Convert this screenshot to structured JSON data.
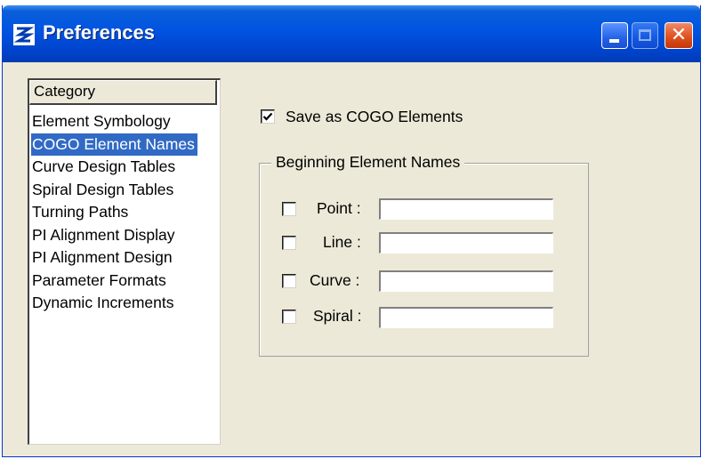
{
  "window": {
    "title": "Preferences"
  },
  "category": {
    "header": "Category",
    "items": [
      "Element Symbology",
      "COGO Element Names",
      "Curve Design Tables",
      "Spiral Design Tables",
      "Turning Paths",
      "PI Alignment Display",
      "PI Alignment Design",
      "Parameter Formats",
      "Dynamic Increments"
    ],
    "selected": "COGO Element Names"
  },
  "options": {
    "save_as_cogo": {
      "label": "Save as COGO Elements",
      "checked": true
    }
  },
  "beginning_names": {
    "legend": "Beginning Element Names",
    "rows": [
      {
        "label": "Point :",
        "checked": false,
        "value": ""
      },
      {
        "label": "Line :",
        "checked": false,
        "value": ""
      },
      {
        "label": "Curve :",
        "checked": false,
        "value": ""
      },
      {
        "label": "Spiral :",
        "checked": false,
        "value": ""
      }
    ]
  },
  "colors": {
    "titlebar": "#0053e1",
    "selection": "#316ac5",
    "face": "#ece9d8"
  }
}
